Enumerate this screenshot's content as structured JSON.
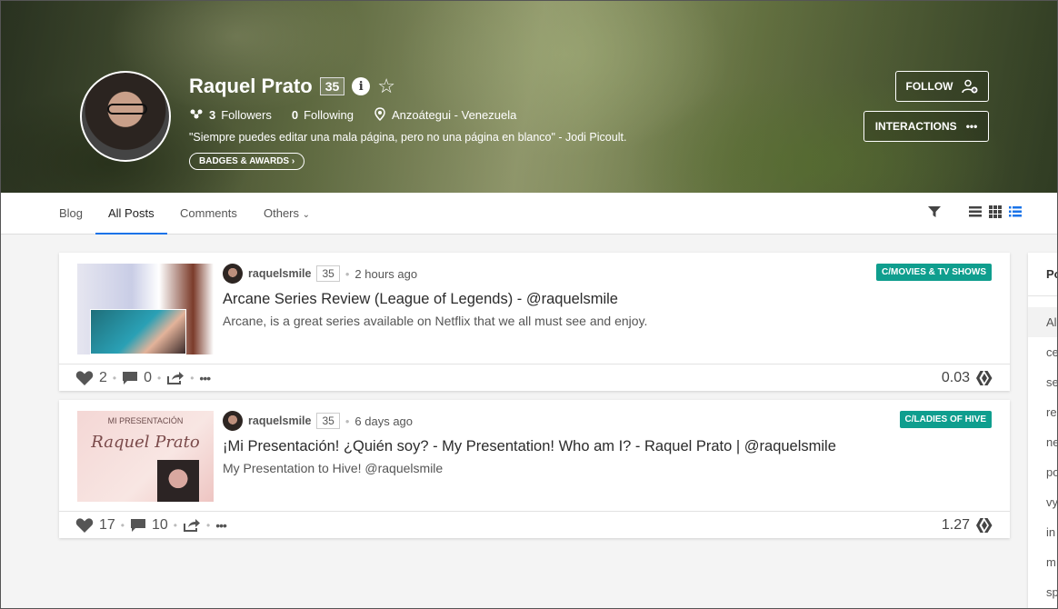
{
  "profile": {
    "name": "Raquel Prato",
    "reputation": "35",
    "followers_count": "3",
    "followers_label": "Followers",
    "following_count": "0",
    "following_label": "Following",
    "location": "Anzoátegui - Venezuela",
    "about": "\"Siempre puedes editar una mala página, pero no una página en blanco\" - Jodi Picoult.",
    "badges_label": "BADGES & AWARDS"
  },
  "actions": {
    "follow_label": "FOLLOW",
    "interactions_label": "INTERACTIONS"
  },
  "nav": {
    "tabs": [
      {
        "label": "Blog"
      },
      {
        "label": "All Posts"
      },
      {
        "label": "Comments"
      },
      {
        "label": "Others"
      }
    ],
    "active_tab": "All Posts"
  },
  "posts": [
    {
      "author": "raquelsmile",
      "reputation": "35",
      "time": "2 hours ago",
      "community": "C/MOVIES & TV SHOWS",
      "title": "Arcane Series Review (League of Legends) - @raquelsmile",
      "summary": "Arcane, is a great series available on Netflix that we all must see and enjoy.",
      "votes": "2",
      "comments": "0",
      "payout": "0.03"
    },
    {
      "author": "raquelsmile",
      "reputation": "35",
      "time": "6 days ago",
      "community": "C/LADIES OF HIVE",
      "title": "¡Mi Presentación! ¿Quién soy? - My Presentation! Who am I? - Raquel Prato | @raquelsmile",
      "summary": "My Presentation to Hive! @raquelsmile",
      "thumb_small": "MI PRESENTACIÓN",
      "thumb_big": "Raquel Prato",
      "votes": "17",
      "comments": "10",
      "payout": "1.27"
    }
  ],
  "side_panel": {
    "header": "Po",
    "items": [
      "Al",
      "ce",
      "se",
      "re",
      "ne",
      "po",
      "vy",
      "in",
      "m",
      "sp"
    ]
  },
  "colors": {
    "accent": "#1a73e8",
    "community_badge": "#0f9e8e"
  }
}
